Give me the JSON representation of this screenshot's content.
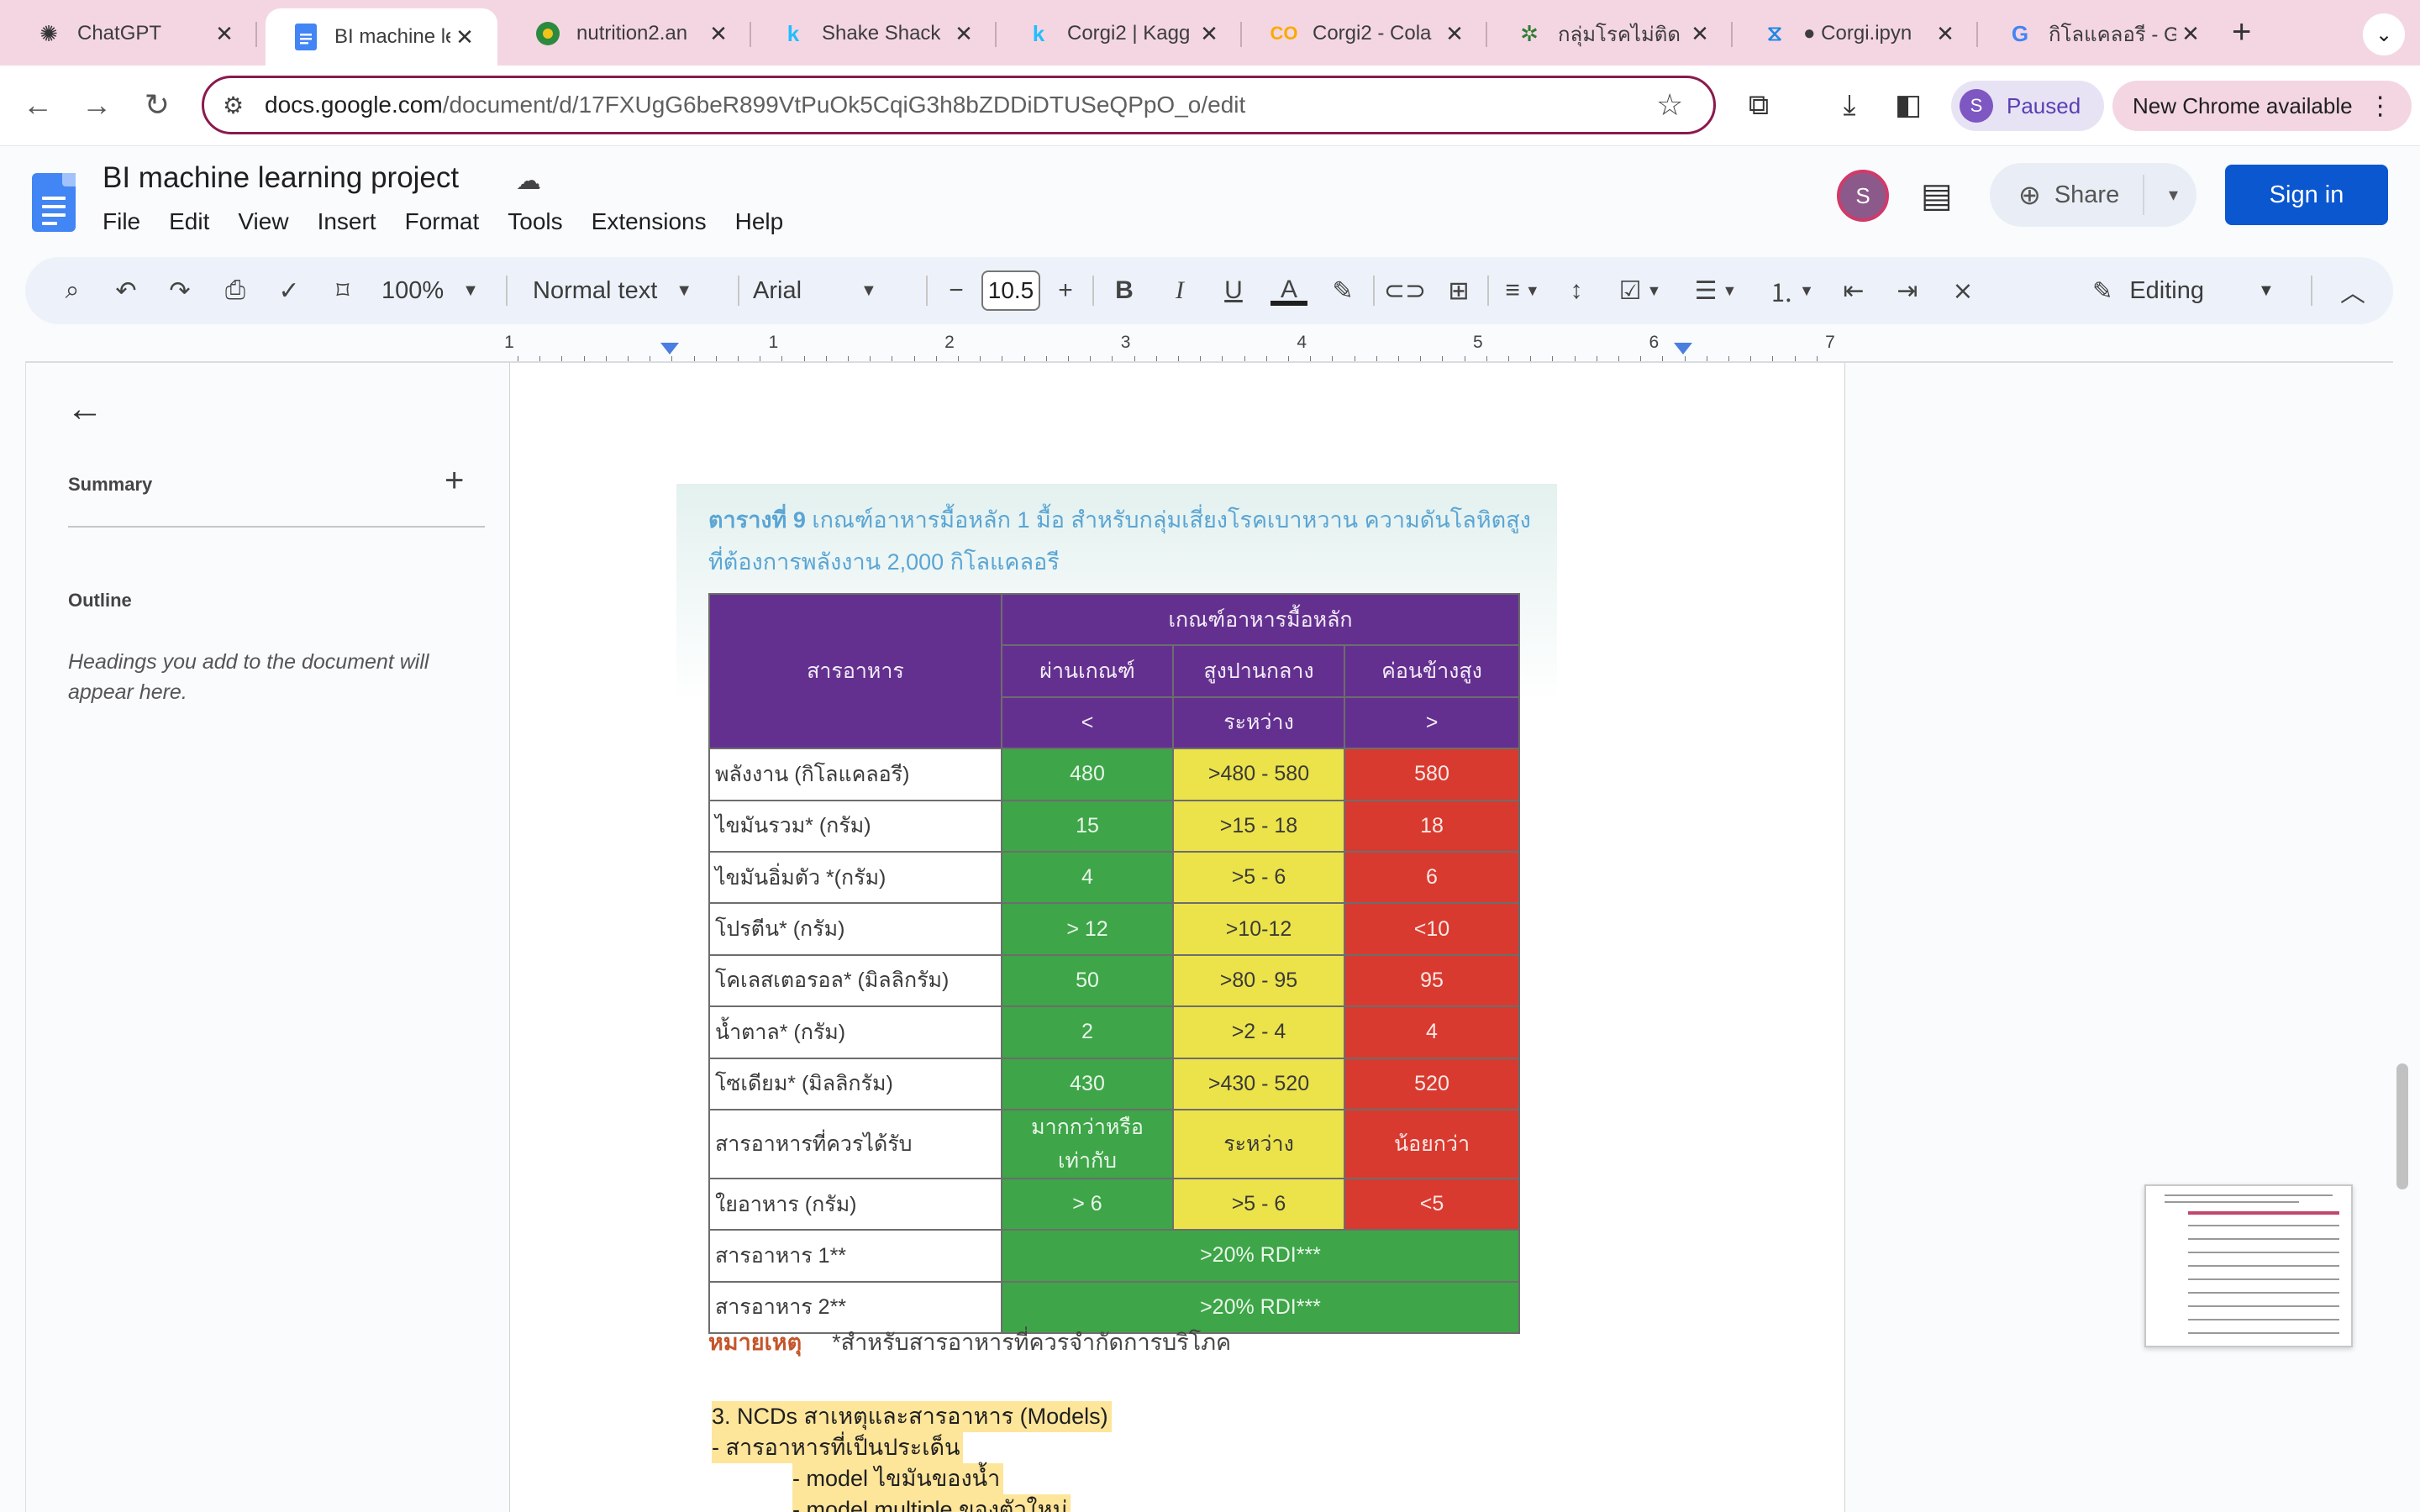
{
  "browser": {
    "tabs": [
      {
        "title": "ChatGPT",
        "icon": "chatgpt-icon",
        "active": false
      },
      {
        "title": "BI machine le",
        "icon": "google-docs-icon",
        "active": true
      },
      {
        "title": "nutrition2.an",
        "icon": "jupyter-icon",
        "active": false
      },
      {
        "title": "Shake Shack",
        "icon": "kaggle-icon",
        "active": false
      },
      {
        "title": "Corgi2 | Kagg",
        "icon": "kaggle-icon",
        "active": false
      },
      {
        "title": "Corgi2 - Cola",
        "icon": "colab-icon",
        "active": false
      },
      {
        "title": "กลุ่มโรคไม่ติด",
        "icon": "ministry-icon",
        "active": false
      },
      {
        "title": "Corgi.ipyn",
        "icon": "vscode-icon",
        "active": false
      },
      {
        "title": "กิโลแคลอรี - G",
        "icon": "google-icon",
        "active": false
      }
    ],
    "url_host": "docs.google.com",
    "url_path": "/document/d/17FXUgG6beR899VtPuOk5CqiG3h8bZDDiDTUSeQPpO_o/edit",
    "profile_initial": "S",
    "profile_status": "Paused",
    "update_label": "New Chrome available"
  },
  "docs": {
    "title": "BI machine learning project",
    "menu": [
      "File",
      "Edit",
      "View",
      "Insert",
      "Format",
      "Tools",
      "Extensions",
      "Help"
    ],
    "user_initial": "S",
    "share_label": "Share",
    "signin_label": "Sign in",
    "toolbar": {
      "zoom": "100%",
      "style": "Normal text",
      "font": "Arial",
      "font_size": "10.5",
      "mode": "Editing"
    },
    "ruler_numbers": [
      "1",
      "1",
      "2",
      "3",
      "4",
      "5",
      "6",
      "7"
    ]
  },
  "outline": {
    "summary_label": "Summary",
    "outline_label": "Outline",
    "hint": "Headings you add to the document will appear here."
  },
  "figure": {
    "caption_bold": "ตารางที่ 9",
    "caption_rest": " เกณฑ์อาหารมื้อหลัก 1 มื้อ สำหรับกลุ่มเสี่ยงโรคเบาหวาน ความดันโลหิตสูง ที่ต้องการพลังงาน 2,000 กิโลแคลอรี",
    "header_nutrient": "สารอาหาร",
    "header_group": "เกณฑ์อาหารมื้อหลัก",
    "levels": [
      "ผ่านเกณฑ์",
      "สูงปานกลาง",
      "ค่อนข้างสูง"
    ],
    "level_symbols": [
      "<",
      "ระหว่าง",
      ">"
    ],
    "rows": [
      {
        "name": "พลังงาน (กิโลแคลอรี)",
        "pass": "480",
        "mid": ">480 - 580",
        "high": "580"
      },
      {
        "name": "ไขมันรวม* (กรัม)",
        "pass": "15",
        "mid": ">15 - 18",
        "high": "18"
      },
      {
        "name": "ไขมันอิ่มตัว *(กรัม)",
        "pass": "4",
        "mid": ">5 - 6",
        "high": "6"
      },
      {
        "name": "โปรตีน* (กรัม)",
        "pass": "> 12",
        "mid": ">10-12",
        "high": "<10"
      },
      {
        "name": "โคเลสเตอรอล* (มิลลิกรัม)",
        "pass": "50",
        "mid": ">80 - 95",
        "high": "95"
      },
      {
        "name": "น้ำตาล* (กรัม)",
        "pass": "2",
        "mid": ">2 - 4",
        "high": "4"
      },
      {
        "name": "โซเดียม* (มิลลิกรัม)",
        "pass": "430",
        "mid": ">430 - 520",
        "high": "520"
      },
      {
        "name": "สารอาหารที่ควรได้รับ",
        "pass": "มากกว่าหรือเท่ากับ",
        "mid": "ระหว่าง",
        "high": "น้อยกว่า"
      },
      {
        "name": "ใยอาหาร (กรัม)",
        "pass": "> 6",
        "mid": ">5 - 6",
        "high": "<5"
      }
    ],
    "span_rows": [
      {
        "name": "สารอาหาร 1**",
        "value": ">20% RDI***"
      },
      {
        "name": "สารอาหาร 2**",
        "value": ">20% RDI***"
      }
    ],
    "note_label": "หมายเหตุ",
    "note_text": "*สำหรับสารอาหารที่ควรจำกัดการบริโภค"
  },
  "body_lines": [
    "3.   NCDs สาเหตุและสารอาหาร (Models)",
    "-     สารอาหารที่เป็นประเด็น",
    "-     model ไขมันของน้ำ",
    "-     model multiple ของตัวใหม่"
  ],
  "colors": {
    "tab_strip": "#f4d6e3",
    "header_purple": "#643090",
    "pass_green": "#3ea548",
    "mid_yellow": "#ece34a",
    "high_red": "#d93a2f",
    "signin_blue": "#0b57d0",
    "highlight": "#fde59a"
  }
}
